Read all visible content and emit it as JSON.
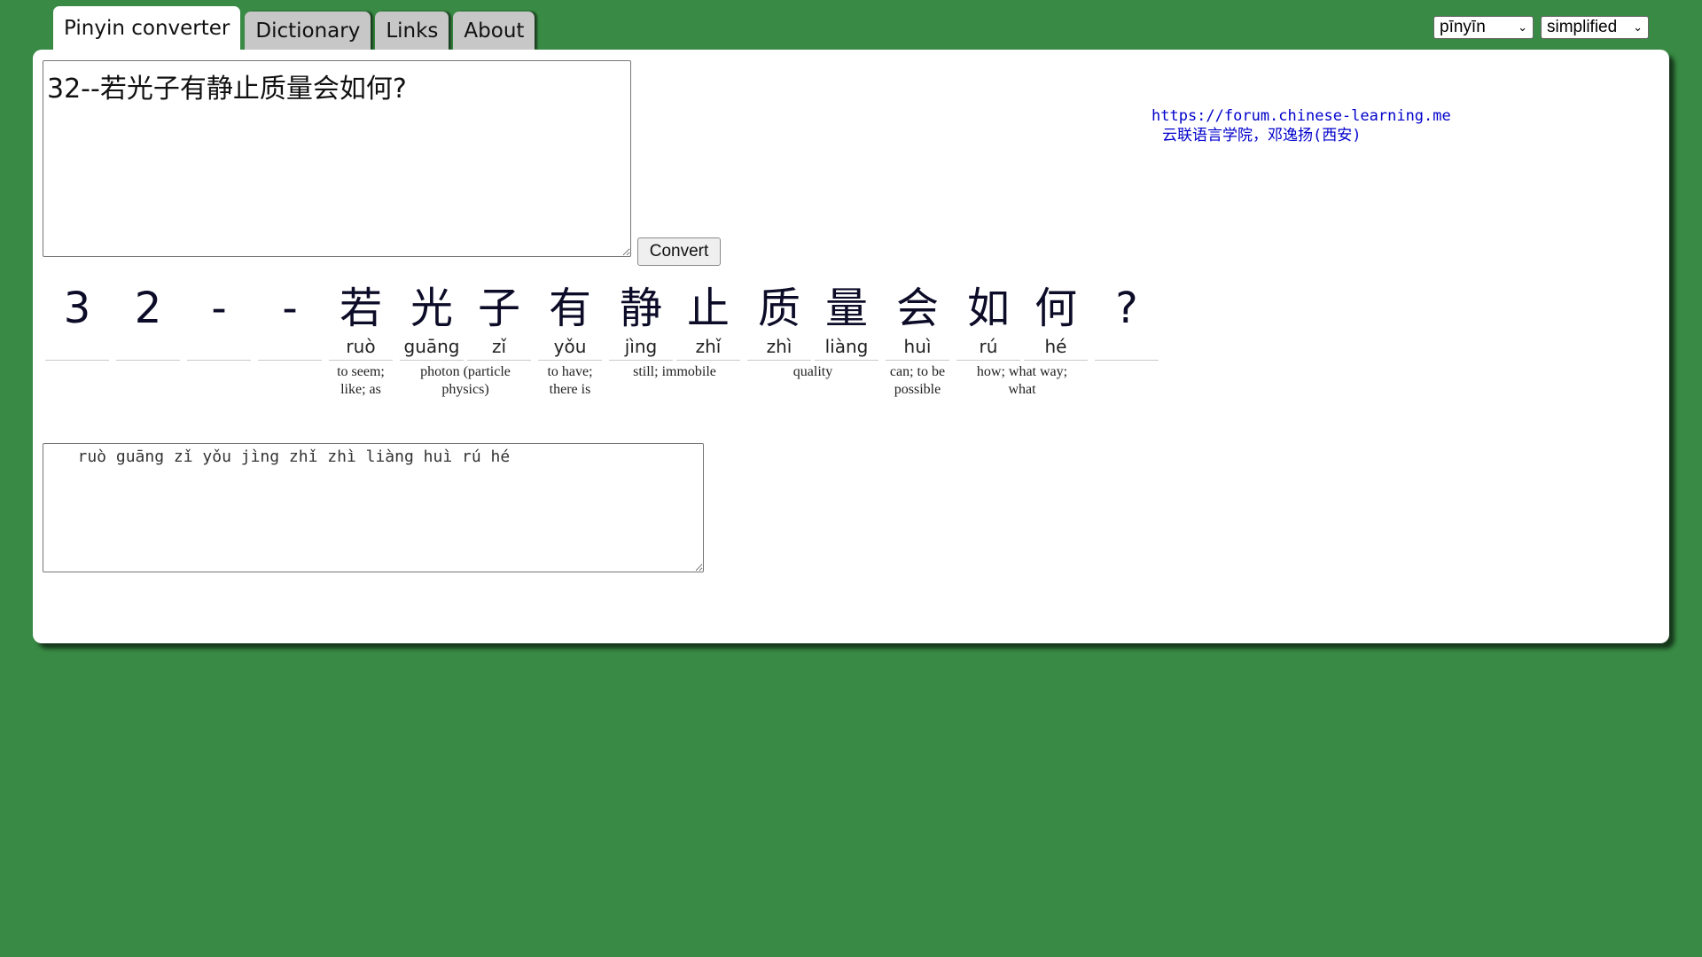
{
  "tabs": [
    {
      "label": "Pinyin converter",
      "active": true
    },
    {
      "label": "Dictionary",
      "active": false
    },
    {
      "label": "Links",
      "active": false
    },
    {
      "label": "About",
      "active": false
    }
  ],
  "selects": {
    "mode": "pīnyīn",
    "script": "simplified"
  },
  "input_text": "32--若光子有静止质量会如何?",
  "convert_label": "Convert",
  "credits": {
    "url": "https://forum.chinese-learning.me",
    "line2": "云联语言学院，邓逸扬(西安)"
  },
  "characters": [
    {
      "hz": "3",
      "py": ""
    },
    {
      "hz": "2",
      "py": ""
    },
    {
      "hz": "-",
      "py": ""
    },
    {
      "hz": "-",
      "py": ""
    },
    {
      "hz": "若",
      "py": "ruò"
    },
    {
      "hz": "光",
      "py": "guāng"
    },
    {
      "hz": "子",
      "py": "zǐ"
    },
    {
      "hz": "有",
      "py": "yǒu"
    },
    {
      "hz": "静",
      "py": "jìng"
    },
    {
      "hz": "止",
      "py": "zhǐ"
    },
    {
      "hz": "质",
      "py": "zhì"
    },
    {
      "hz": "量",
      "py": "liàng"
    },
    {
      "hz": "会",
      "py": "huì"
    },
    {
      "hz": "如",
      "py": "rú"
    },
    {
      "hz": "何",
      "py": "hé"
    },
    {
      "hz": "?",
      "py": ""
    }
  ],
  "glosses": [
    {
      "text": "to seem;\nlike; as"
    },
    {
      "text": "photon (particle\nphysics)"
    },
    {
      "text": "to have;\nthere is"
    },
    {
      "text": "still; immobile"
    },
    {
      "text": "quality"
    },
    {
      "text": "can; to be\npossible"
    },
    {
      "text": "how; what way;\nwhat"
    }
  ],
  "output_text": "   ruò guāng zǐ yǒu jìng zhǐ zhì liàng huì rú hé"
}
